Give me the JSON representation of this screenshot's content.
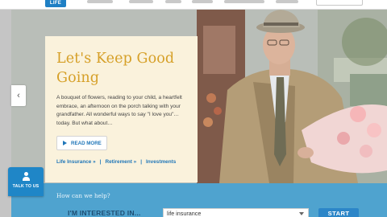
{
  "header": {
    "logo_text": "LIFE"
  },
  "hero": {
    "title": "Let's Keep Good Going",
    "body": "A bouquet of flowers, reading to your child, a heartfelt embrace, an afternoon on the porch talking with your grandfather. All wonderful ways to say \"I love you\"…today. But what about…",
    "read_more_label": "READ MORE",
    "links": [
      "Life Insurance »",
      "Retirement »",
      "Investments"
    ],
    "prev_arrow": "‹",
    "photo_subject": "elderly-man-with-flowers-photo"
  },
  "talk": {
    "label": "TALK TO US",
    "icon": "person-icon"
  },
  "help": {
    "question": "How can we help?",
    "interested_label": "I'M INTERESTED IN...",
    "select_value": "life insurance",
    "start_label": "START"
  },
  "colors": {
    "title_gold": "#d6a028",
    "link_blue": "#1f76b8",
    "card_cream": "#faf2dc",
    "help_bar_blue": "#4fa3cf",
    "button_blue": "#2c86c8"
  }
}
